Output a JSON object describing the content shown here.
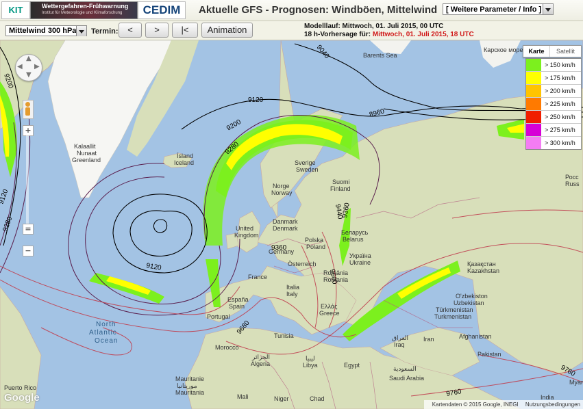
{
  "header": {
    "logo_kit": "KIT",
    "logo_banner_title": "Wettergefahren-Frühwarnung",
    "logo_banner_sub": "Institut für Meteorologie und Klimaforschung",
    "logo_cedim": "CEDIM",
    "title": "Aktuelle GFS - Prognosen: Windböen, Mittelwind",
    "param_select": "[ Weitere Parameter / Info ]"
  },
  "controls": {
    "level_select": "Mittelwind 300 hPa",
    "termin_label": "Termin:",
    "prev": "<",
    "next": ">",
    "first": "|<",
    "animation": "Animation",
    "model_run": "Modelllauf: Mittwoch, 01. Juli 2015, 00 UTC",
    "forecast_prefix": "18 h-Vorhersage für: ",
    "forecast_value": "Mittwoch, 01. Juli 2015, 18 UTC"
  },
  "map": {
    "map_type": {
      "karte": "Karte",
      "satellit": "Satellit",
      "active": "Karte"
    },
    "legend": [
      {
        "label": "> 150 km/h",
        "color": "#7cf01e"
      },
      {
        "label": "> 175 km/h",
        "color": "#ffff00"
      },
      {
        "label": "> 200 km/h",
        "color": "#ffc400"
      },
      {
        "label": "> 225 km/h",
        "color": "#ff7a00"
      },
      {
        "label": "> 250 km/h",
        "color": "#f01e00"
      },
      {
        "label": "> 275 km/h",
        "color": "#d600d6"
      },
      {
        "label": "> 300 km/h",
        "color": "#f47cf4"
      }
    ],
    "contour_labels": [
      "9200",
      "9040",
      "9120",
      "8960",
      "9200",
      "9280",
      "9120",
      "9120",
      "9280",
      "9440",
      "9360",
      "9360",
      "9600",
      "9680",
      "9760",
      "9760"
    ],
    "place_labels": {
      "barents_sea": "Barents Sea",
      "kalaallit1": "Kalaallit",
      "kalaallit2": "Nunaat",
      "kalaallit3": "Greenland",
      "island1": "Ísland",
      "island2": "Iceland",
      "sverige1": "Sverige",
      "sverige2": "Sweden",
      "norge1": "Norge",
      "norge2": "Norway",
      "suomi1": "Suomi",
      "suomi2": "Finland",
      "uk1": "United",
      "uk2": "Kingdom",
      "denmark1": "Danmark",
      "denmark2": "Denmark",
      "poland1": "Polska",
      "poland2": "Poland",
      "belarus1": "Беларусь",
      "belarus2": "Belarus",
      "germany2": "Germany",
      "ukraine1": "Україна",
      "ukraine2": "Ukraine",
      "austria": "Österreich",
      "france": "France",
      "italy1": "Italia",
      "italy2": "Italy",
      "romania1": "România",
      "romania2": "Romania",
      "spain1": "España",
      "spain2": "Spain",
      "portugal": "Portugal",
      "greece1": "Ελλάς",
      "greece2": "Greece",
      "tunisia": "Tunisia",
      "morocco": "Morocco",
      "algeria1": "الجزائر",
      "algeria2": "Algeria",
      "libya1": "ليبيا",
      "libya2": "Libya",
      "egypt": "Egypt",
      "mali": "Mali",
      "niger": "Niger",
      "chad": "Chad",
      "mauritania1": "Mauritanie",
      "mauritania2": "موريتانيا",
      "mauritania3": "Mauritania",
      "north_atlantic1": "North",
      "north_atlantic2": "Atlantic",
      "north_atlantic3": "Ocean",
      "kazakhstan1": "Қазақстан",
      "kazakhstan2": "Kazakhstan",
      "uzbekistan1": "O'zbekiston",
      "uzbekistan2": "Uzbekistan",
      "turkmenistan1": "Türkmenistan",
      "turkmenistan2": "Turkmenistan",
      "afghanistan": "Afghanistan",
      "iraq1": "العراق",
      "iraq2": "Iraq",
      "iran": "Iran",
      "saudi1": "السعودية",
      "saudi2": "Saudi Arabia",
      "pakistan": "Pakistan",
      "russia1": "Росс",
      "russia2": "Russ",
      "kara_sea": "Карское море",
      "puerto_rico": "Puerto Rico",
      "india": "India",
      "myanmar": "Myar"
    },
    "google": "Google",
    "attribution": "Kartendaten © 2015 Google, INEGI",
    "terms": "Nutzungsbedingungen"
  }
}
